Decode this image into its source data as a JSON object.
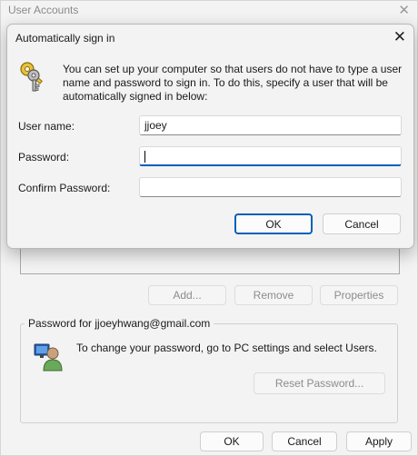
{
  "parent": {
    "title": "User Accounts",
    "close_glyph": "✕",
    "buttons": {
      "add": "Add...",
      "remove": "Remove",
      "properties": "Properties"
    },
    "password_group": {
      "legend": "Password for jjoeyhwang@gmail.com",
      "text": "To change your password, go to PC settings and select Users.",
      "reset_label": "Reset Password..."
    },
    "footer": {
      "ok": "OK",
      "cancel": "Cancel",
      "apply": "Apply"
    }
  },
  "dialog": {
    "title": "Automatically sign in",
    "close_glyph": "✕",
    "description": "You can set up your computer so that users do not have to type a user name and password to sign in. To do this, specify a user that will be automatically signed in below:",
    "fields": {
      "user_name_label": "User name:",
      "user_name_value": "jjoey",
      "password_label": "Password:",
      "password_value": "",
      "confirm_label": "Confirm Password:",
      "confirm_value": ""
    },
    "ok": "OK",
    "cancel": "Cancel"
  },
  "colors": {
    "accent": "#005fb8",
    "window_bg": "#f3f3f3"
  }
}
